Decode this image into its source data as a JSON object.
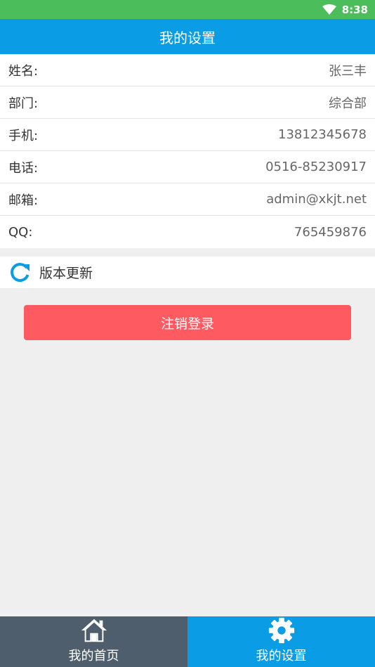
{
  "status": {
    "time": "8:38"
  },
  "header": {
    "title": "我的设置"
  },
  "profile": {
    "rows": [
      {
        "label": "姓名:",
        "value": "张三丰"
      },
      {
        "label": "部门:",
        "value": "综合部"
      },
      {
        "label": "手机:",
        "value": "13812345678"
      },
      {
        "label": "电话:",
        "value": "0516-85230917"
      },
      {
        "label": "邮箱:",
        "value": "admin@xkjt.net"
      },
      {
        "label": "QQ:",
        "value": "765459876"
      }
    ]
  },
  "update": {
    "label": "版本更新",
    "icon": "refresh-icon"
  },
  "logout": {
    "label": "注销登录"
  },
  "nav": {
    "items": [
      {
        "label": "我的首页",
        "icon": "home-icon"
      },
      {
        "label": "我的设置",
        "icon": "gear-icon"
      }
    ]
  },
  "colors": {
    "status_bar": "#4cbd5b",
    "primary": "#0a9de6",
    "logout": "#fd5a62",
    "nav_inactive": "#4f5e6d"
  }
}
